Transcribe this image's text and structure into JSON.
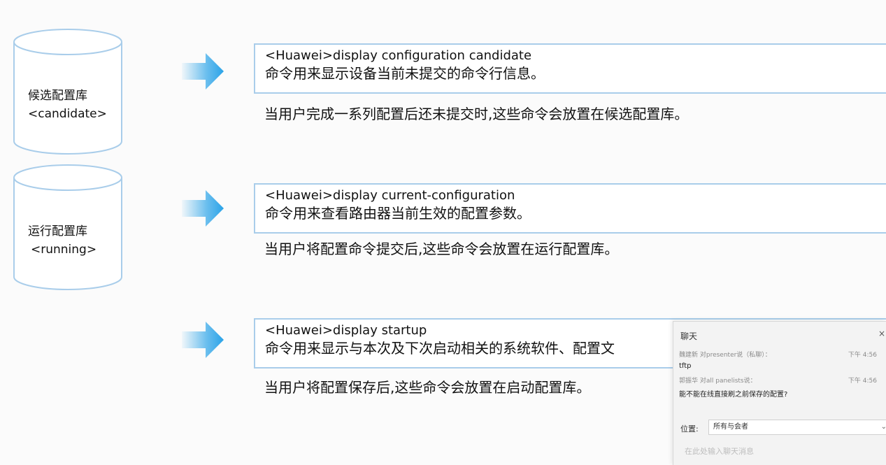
{
  "databases": [
    {
      "name": "候选配置库",
      "tag": "<candidate>"
    },
    {
      "name": "运行配置库",
      "tag": "<running>"
    }
  ],
  "commands": [
    {
      "command": "<Huawei>display configuration candidate",
      "description": "命令用来显示设备当前未提交的命令行信息。",
      "note": "当用户完成一系列配置后还未提交时,这些命令会放置在候选配置库。"
    },
    {
      "command": "<Huawei>display current-configuration",
      "description": "命令用来查看路由器当前生效的配置参数。",
      "note": "当用户将配置命令提交后,这些命令会放置在运行配置库。"
    },
    {
      "command": "<Huawei>display startup",
      "description": "命令用来显示与本次及下次启动相关的系统软件、配置文",
      "note": "当用户将配置保存后,这些命令会放置在启动配置库。"
    }
  ],
  "chat": {
    "title": "聊天",
    "close": "×",
    "messages": [
      {
        "meta": "魏建新 对presenter说（私聊）：",
        "time": "下午 4:56",
        "text": "tftp"
      },
      {
        "meta": "郭振华 对all panelists说：",
        "time": "下午 4:56",
        "text": "能不能在线直接刷之前保存的配置?"
      }
    ],
    "scope_label": "位置:",
    "scope_value": "所有与会者",
    "input_placeholder": "在此处输入聊天消息"
  },
  "colors": {
    "box_border": "#a9cdea",
    "cylinder_stroke": "#a9cdea",
    "arrow_blue": "#2aa3e8"
  }
}
